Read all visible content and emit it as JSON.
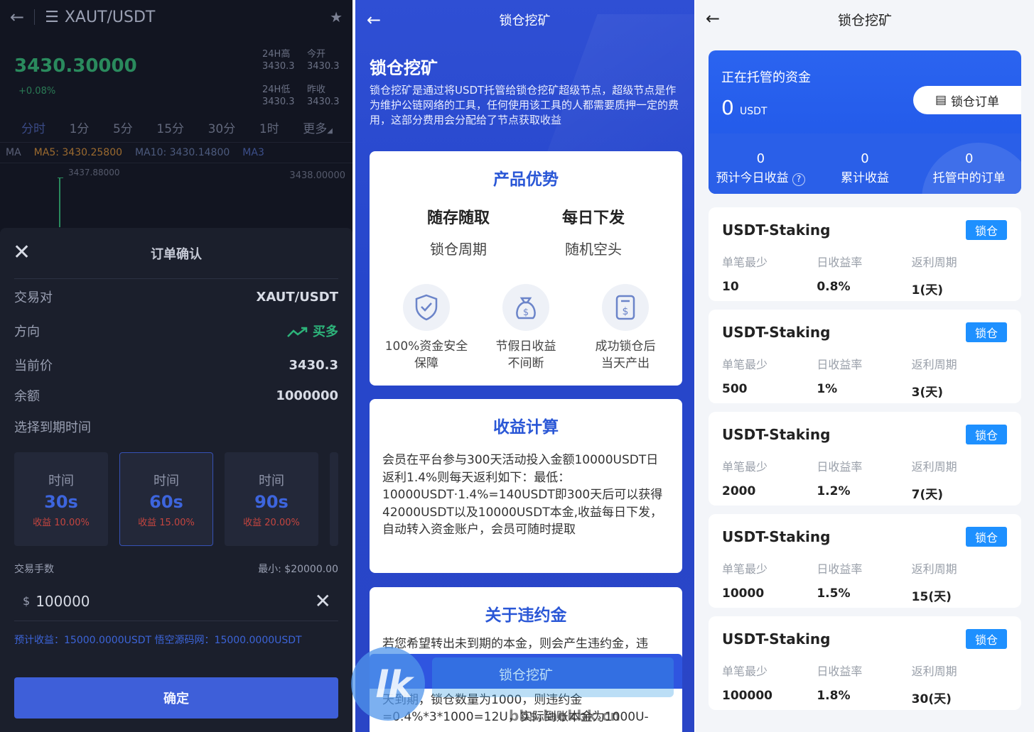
{
  "trade": {
    "pair": "XAUT/USDT",
    "price": "3430.30000",
    "change": "+0.08%",
    "stats": {
      "high_label": "24H高",
      "high_value": "3430.3",
      "open_label": "今开",
      "open_value": "3430.3",
      "low_label": "24H低",
      "low_value": "3430.3",
      "prev_label": "昨收",
      "prev_value": "3430.3"
    },
    "periods": [
      "分时",
      "1分",
      "5分",
      "15分",
      "30分",
      "1时",
      "更多"
    ],
    "ma": {
      "ma": "MA",
      "ma5": "MA5: 3430.25800",
      "ma10": "MA10: 3430.14800",
      "ma30": "MA3"
    },
    "chart_high": "3437.88000",
    "chart_right": "3438.00000",
    "order": {
      "title": "订单确认",
      "pair_label": "交易对",
      "pair_value": "XAUT/USDT",
      "dir_label": "方向",
      "dir_value": "买多",
      "price_label": "当前价",
      "price_value": "3430.3",
      "balance_label": "余额",
      "balance_value": "1000000",
      "expiry_label": "选择到期时间",
      "options": [
        {
          "time_label": "时间",
          "time": "30s",
          "profit": "收益 10.00%"
        },
        {
          "time_label": "时间",
          "time": "60s",
          "profit": "收益 15.00%"
        },
        {
          "time_label": "时间",
          "time": "90s",
          "profit": "收益 20.00%"
        }
      ],
      "qty_label": "交易手数",
      "min_label": "最小: $20000.00",
      "currency": "$",
      "amount": "100000",
      "estimate": "预计收益：15000.0000USDT   悟空源码网：15000.0000USDT",
      "confirm": "确定"
    }
  },
  "intro": {
    "nav_title": "锁仓挖矿",
    "title": "锁仓挖矿",
    "desc": "锁仓挖矿是通过将USDT托管给锁仓挖矿超级节点，超级节点是作为维护公链网络的工具，任何使用该工具的人都需要质押一定的费用，这部分费用会分配给了节点获取收益",
    "adv_title": "产品优势",
    "adv_cols": [
      {
        "big": "随存随取",
        "small": "锁仓周期"
      },
      {
        "big": "每日下发",
        "small": "随机空头"
      }
    ],
    "features": [
      {
        "icon": "shield-check-icon",
        "label1": "100%资金安全",
        "label2": "保障"
      },
      {
        "icon": "money-bag-icon",
        "label1": "节假日收益",
        "label2": "不间断"
      },
      {
        "icon": "dollar-doc-icon",
        "label1": "成功锁仓后",
        "label2": "当天产出"
      }
    ],
    "calc_title": "收益计算",
    "calc_text": "会员在平台参与300天活动投入金额10000USDT日返利1.4%则每天返利如下：最低：10000USDT·1.4%=140USDT即300天后可以获得42000USDT以及10000USDT本金,收益每日下发，自动转入资金账户，会员可随时提取",
    "penalty_title": "关于违约金",
    "penalty_text1": "若您希望转出未到期的本金，则会产生违约金，违",
    "penalty_text2": "天到期，锁仓数量为1000，则违约金",
    "penalty_text3": "=0.4%*3*1000=12U，实际到账本金为1000U-",
    "button": "锁仓挖矿",
    "watermark": "bbs.laokbk.cn"
  },
  "staking": {
    "nav_title": "锁仓挖矿",
    "hero_label": "正在托管的资金",
    "hero_value": "0",
    "hero_unit": "USDT",
    "orders_button": "锁仓订单",
    "stats": [
      {
        "value": "0",
        "label": "预计今日收益"
      },
      {
        "value": "0",
        "label": "累计收益"
      },
      {
        "value": "0",
        "label": "托管中的订单"
      }
    ],
    "col_labels": [
      "单笔最少",
      "日收益率",
      "返利周期"
    ],
    "lock_label": "锁仓",
    "plans": [
      {
        "name": "USDT-Staking",
        "min": "10",
        "rate": "0.8%",
        "cycle": "1(天)"
      },
      {
        "name": "USDT-Staking",
        "min": "500",
        "rate": "1%",
        "cycle": "3(天)"
      },
      {
        "name": "USDT-Staking",
        "min": "2000",
        "rate": "1.2%",
        "cycle": "7(天)"
      },
      {
        "name": "USDT-Staking",
        "min": "10000",
        "rate": "1.5%",
        "cycle": "15(天)"
      },
      {
        "name": "USDT-Staking",
        "min": "100000",
        "rate": "1.8%",
        "cycle": "30(天)"
      }
    ]
  }
}
